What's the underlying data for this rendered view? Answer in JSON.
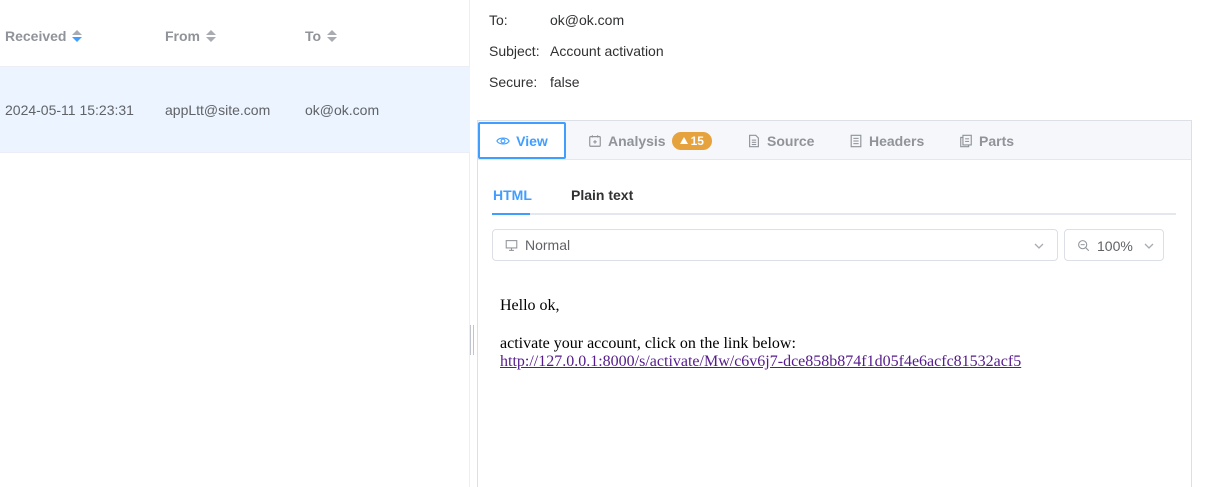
{
  "list": {
    "columns": [
      {
        "label": "Received",
        "sort": "desc"
      },
      {
        "label": "From",
        "sort": "none"
      },
      {
        "label": "To",
        "sort": "none"
      }
    ],
    "rows": [
      {
        "received": "2024-05-11 15:23:31",
        "from": "appLtt@site.com",
        "to": "ok@ok.com",
        "selected": true
      }
    ]
  },
  "message": {
    "to_label": "To:",
    "to_value": "ok@ok.com",
    "subject_label": "Subject:",
    "subject_value": "Account activation",
    "secure_label": "Secure:",
    "secure_value": "false"
  },
  "tabs": [
    {
      "label": "View",
      "icon": "eye-icon",
      "active": true
    },
    {
      "label": "Analysis",
      "icon": "analysis-icon",
      "badge": "15"
    },
    {
      "label": "Source",
      "icon": "document-icon"
    },
    {
      "label": "Headers",
      "icon": "list-icon"
    },
    {
      "label": "Parts",
      "icon": "copy-icon"
    }
  ],
  "subtabs": [
    {
      "label": "HTML",
      "active": true
    },
    {
      "label": "Plain text"
    }
  ],
  "device_select": {
    "value": "Normal",
    "icon": "monitor-icon"
  },
  "zoom_select": {
    "value": "100%",
    "icon": "zoom-icon"
  },
  "body": {
    "greeting": "Hello ok,",
    "line": "activate your account, click on the link below:",
    "link": "http://127.0.0.1:8000/s/activate/Mw/c6v6j7-dce858b874f1d05f4e6acfc81532acf5"
  },
  "colors": {
    "accent": "#409eff",
    "selected_row": "#ecf5ff",
    "badge": "#e6a23c",
    "link": "#551a8b"
  }
}
